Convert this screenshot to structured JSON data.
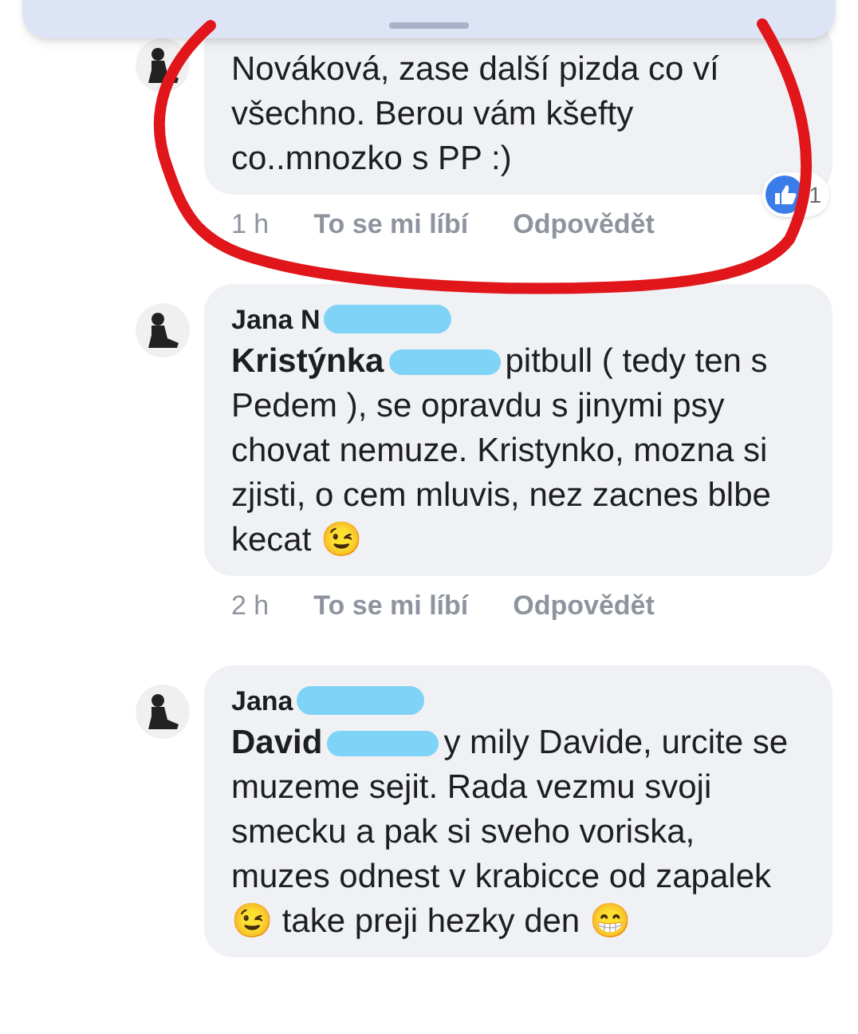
{
  "comments": [
    {
      "body": "Nováková, zase další pizda co ví všechno. Berou vám kšefty co..mnozko s PP :)",
      "time": "1 h",
      "like": "To se mi líbí",
      "reply": "Odpovědět",
      "reactions": "1"
    },
    {
      "author": "Jana N",
      "mention": "Kristýnka",
      "body": "pitbull ( tedy ten s Pedem ), se opravdu s jinymi psy chovat nemuze. Kristynko, mozna si zjisti, o cem mluvis, nez zacnes blbe kecat 😉",
      "time": "2 h",
      "like": "To se mi líbí",
      "reply": "Odpovědět"
    },
    {
      "author": "Jana",
      "mention": "David",
      "body": "y mily Davide, urcite se muzeme sejit. Rada vezmu svoji smecku a pak si sveho voriska, muzes odnest v krabicce od zapalek 😉 take preji hezky den 😁"
    }
  ]
}
